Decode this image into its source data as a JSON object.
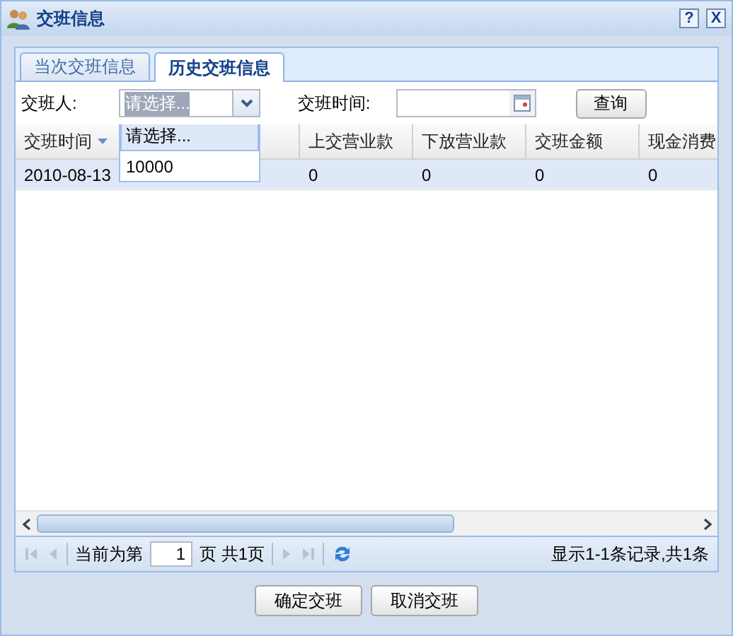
{
  "window": {
    "title": "交班信息",
    "help_button": "?",
    "close_button": "X"
  },
  "tabs": [
    {
      "label": "当次交班信息",
      "selected": false
    },
    {
      "label": "历史交班信息",
      "selected": true
    }
  ],
  "filters": {
    "person_label": "交班人:",
    "person_value": "请选择...",
    "time_label": "交班时间:",
    "query_button": "查询"
  },
  "dropdown": {
    "options": [
      {
        "label": "请选择...",
        "selected": true
      },
      {
        "label": "10000",
        "selected": false
      }
    ]
  },
  "table": {
    "columns": [
      {
        "label": "交班时间",
        "sorted": true
      },
      {
        "label": "上交营业款"
      },
      {
        "label": "下放营业款"
      },
      {
        "label": "交班金额"
      },
      {
        "label": "现金消费"
      }
    ],
    "rows": [
      {
        "selected": true,
        "cells": [
          "2010-08-13",
          "0",
          "0",
          "0",
          "0"
        ]
      }
    ]
  },
  "pager": {
    "before": "当前为第",
    "page": "1",
    "after": "页 共1页",
    "summary": "显示1-1条记录,共1条"
  },
  "buttons": [
    "确定交班",
    "取消交班"
  ]
}
